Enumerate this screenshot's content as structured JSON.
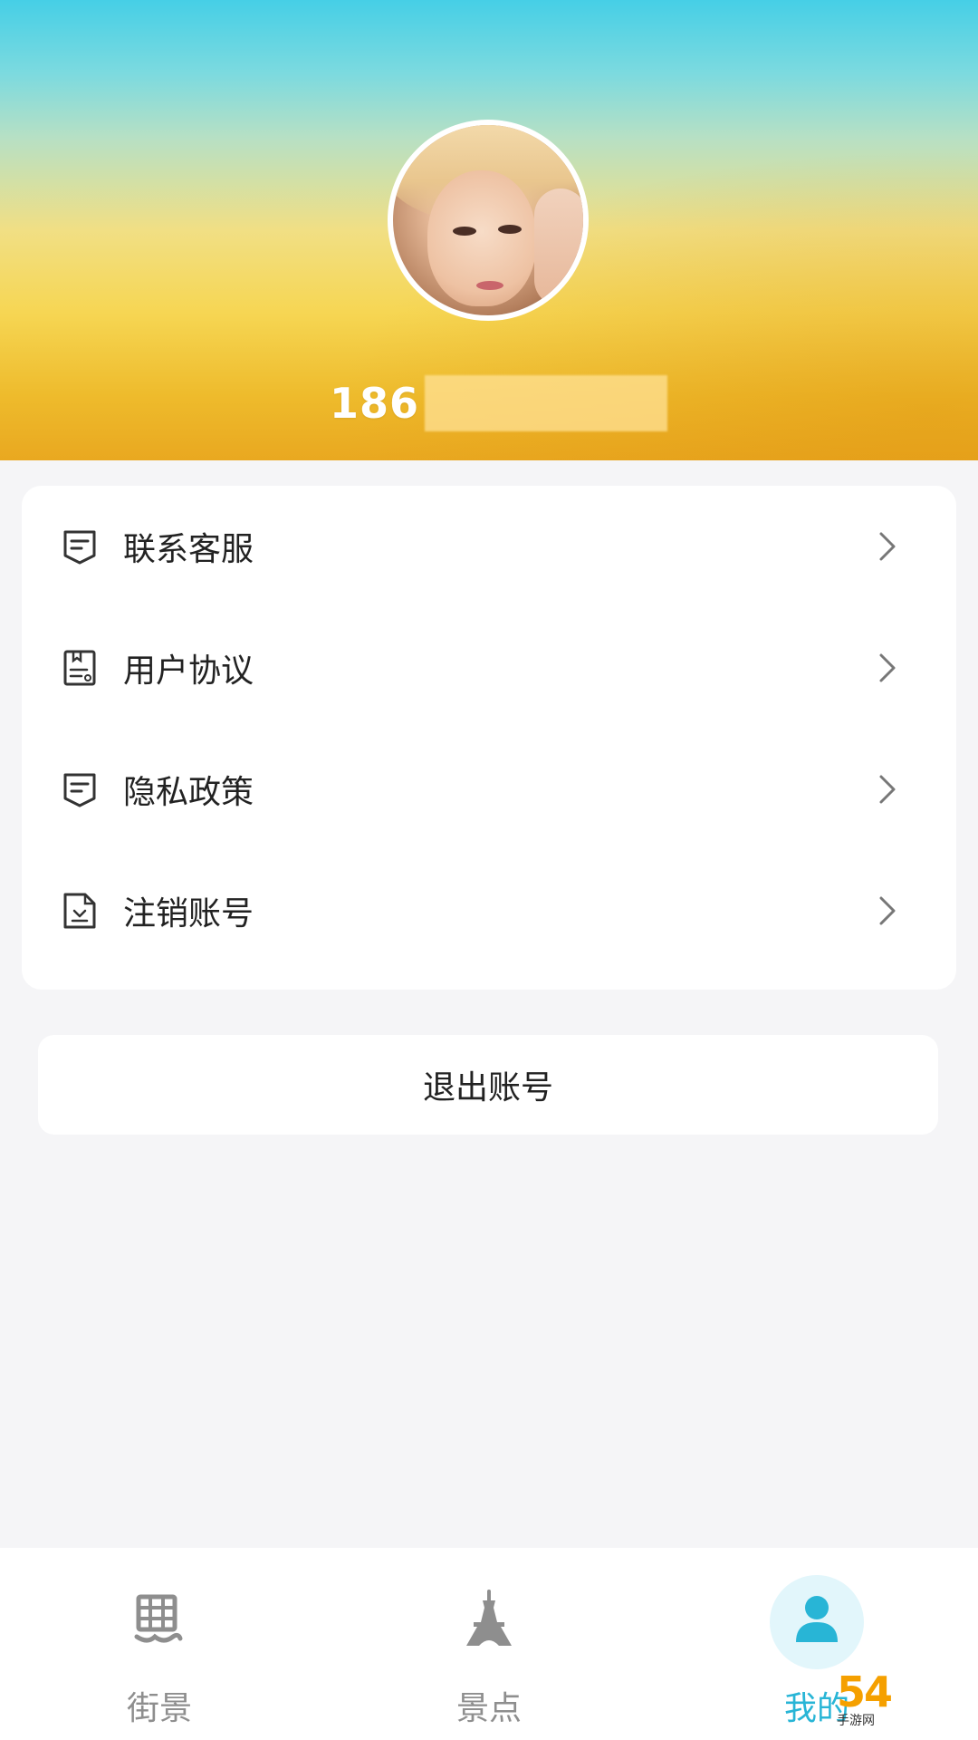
{
  "profile": {
    "phone_prefix": "186",
    "phone_masked": true
  },
  "menu": {
    "items": [
      {
        "label": "联系客服",
        "icon": "customer-service-icon"
      },
      {
        "label": "用户协议",
        "icon": "user-agreement-icon"
      },
      {
        "label": "隐私政策",
        "icon": "privacy-policy-icon"
      },
      {
        "label": "注销账号",
        "icon": "delete-account-icon"
      }
    ]
  },
  "logout": {
    "label": "退出账号"
  },
  "tabbar": {
    "tabs": [
      {
        "label": "街景",
        "icon": "street-view-icon",
        "active": false
      },
      {
        "label": "景点",
        "icon": "attractions-icon",
        "active": false
      },
      {
        "label": "我的",
        "icon": "profile-icon",
        "active": true
      }
    ]
  },
  "watermark": {
    "text": "54",
    "sub": "手游网"
  },
  "colors": {
    "accent": "#28b5d6",
    "tab_inactive": "#8e8e8e",
    "text": "#222222",
    "background": "#f5f5f7"
  }
}
